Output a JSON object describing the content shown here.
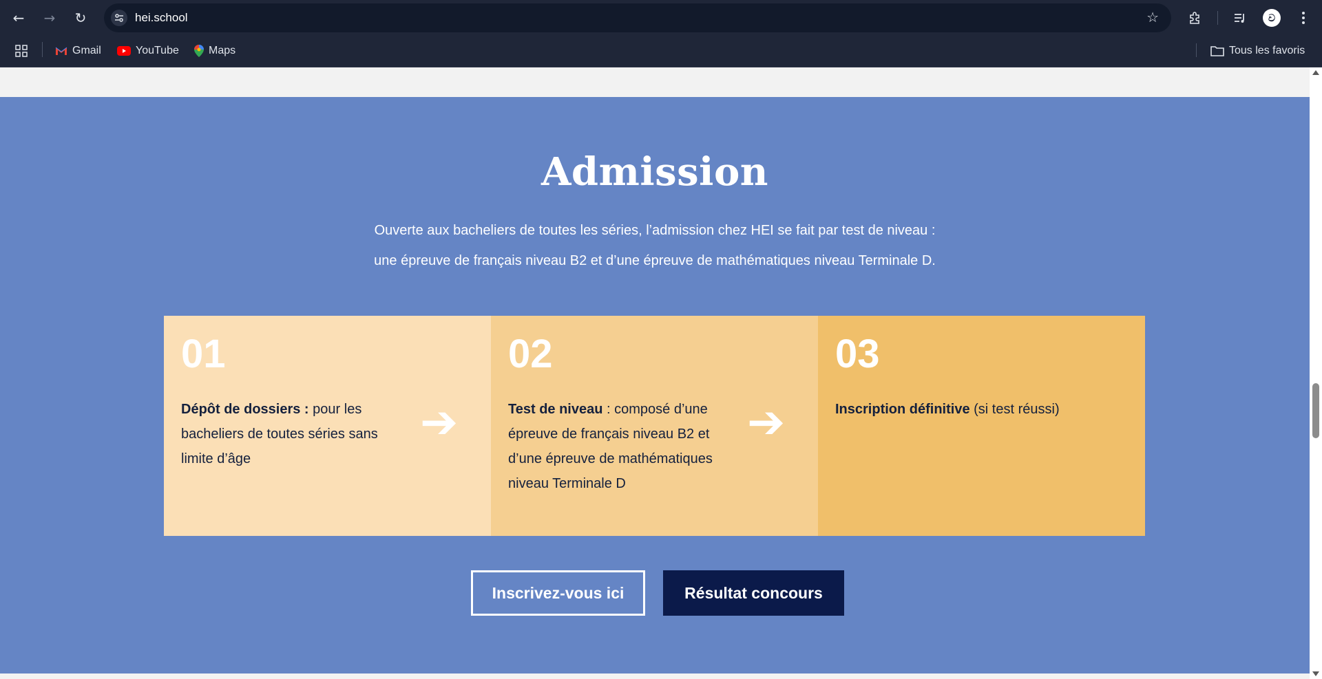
{
  "browser": {
    "url": "hei.school",
    "profile_initial": "ව",
    "nav": {
      "back_icon": "←",
      "forward_icon": "→",
      "reload_icon": "↻"
    },
    "star_icon": "☆",
    "bookmarks": [
      {
        "label": "Gmail"
      },
      {
        "label": "YouTube"
      },
      {
        "label": "Maps"
      }
    ],
    "all_bookmarks_label": "Tous les favoris"
  },
  "admission": {
    "title": "Admission",
    "intro_line1": "Ouverte aux bacheliers de toutes les séries, l’admission chez HEI se fait par test de niveau :",
    "intro_line2": "une épreuve de français niveau B2 et d’une épreuve de mathématiques niveau Terminale D.",
    "steps": [
      {
        "number": "01",
        "bold": "Dépôt de dossiers :",
        "text": " pour les bacheliers de toutes séries sans limite d’âge"
      },
      {
        "number": "02",
        "bold": "Test de niveau",
        "text": " : composé d’une épreuve de français niveau B2 et d’une épreuve de mathématiques niveau Terminale D"
      },
      {
        "number": "03",
        "bold": "Inscription définitive",
        "text": " (si test réussi)"
      }
    ],
    "arrow_glyph": "➔",
    "buttons": {
      "register": "Inscrivez-vous ici",
      "results": "Résultat concours"
    }
  },
  "colors": {
    "section_bg": "#6585c5",
    "step1": "#fbdfb6",
    "step2": "#f5cf91",
    "step3": "#f0bf6a",
    "dark_button": "#0b1a4a"
  }
}
